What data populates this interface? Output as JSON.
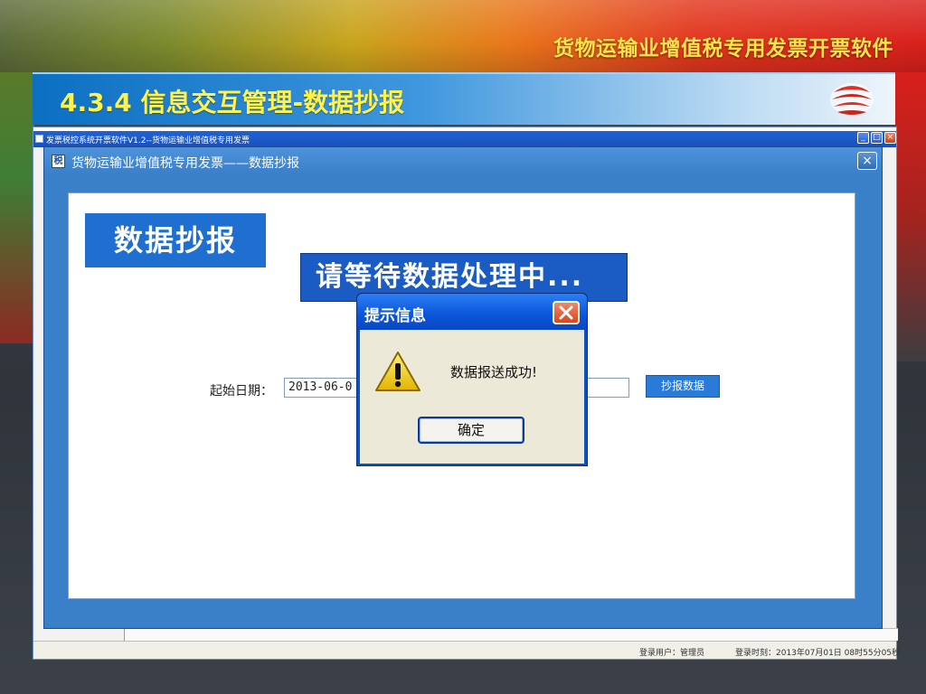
{
  "slide": {
    "header": "货物运输业增值税专用发票开票软件",
    "title": "4.3.4 信息交互管理-数据抄报"
  },
  "app_window": {
    "title": "发票税控系统开票软件V1.2--货物运输业增值税专用发票",
    "controls": [
      "_",
      "□",
      "×"
    ],
    "status": {
      "user": "登录用户：管理员",
      "time": "登录时刻：2013年07月01日 08时55分05秒"
    }
  },
  "dialog": {
    "icon_char": "税",
    "title": "货物运输业增值税专用发票——数据抄报",
    "close": "×",
    "heading": "数据抄报",
    "processing": "请等待数据处理中...",
    "start_date_label": "起始日期：",
    "start_date_value": "2013-06-0",
    "copy_button": "抄报数据"
  },
  "message_box": {
    "title": "提示信息",
    "text": "数据报送成功!",
    "ok_button": "确定",
    "icon": "warning-icon"
  },
  "colors": {
    "header_text": "#ffe34a",
    "title_text": "#fff34a",
    "dialog_blue": "#3a80c9",
    "xp_blue": "#0b52c9",
    "xp_close": "#d9471f"
  }
}
